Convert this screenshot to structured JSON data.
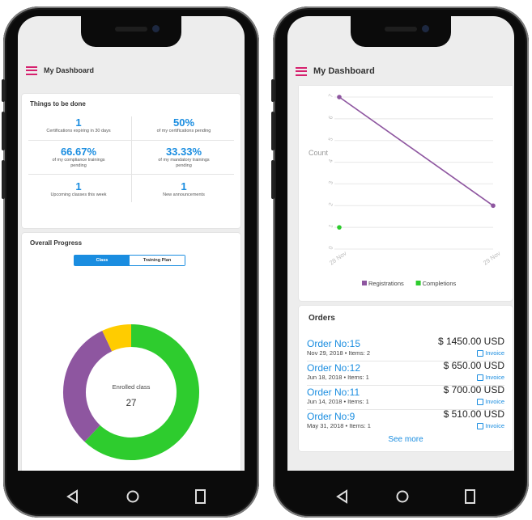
{
  "left_screen": {
    "app_title": "My Dashboard",
    "todo": {
      "title": "Things to be done",
      "stats": [
        {
          "value": "1",
          "label": "Certifications expiring in 30 days"
        },
        {
          "value": "50%",
          "label": "of my certifications pending"
        },
        {
          "value": "66.67%",
          "label": "of my compliance trainings pending"
        },
        {
          "value": "33.33%",
          "label": "of my mandatory trainings pending"
        },
        {
          "value": "1",
          "label": "Upcoming classes this week"
        },
        {
          "value": "1",
          "label": "New announcements"
        }
      ]
    },
    "progress": {
      "title": "Overall Progress",
      "tabs": [
        "Class",
        "Training Plan"
      ],
      "donut_label": "Enrolled class",
      "donut_value": "27",
      "segments": [
        {
          "fraction": 0.62,
          "color": "#2ecc2e"
        },
        {
          "fraction": 0.31,
          "color": "#8e56a0"
        },
        {
          "fraction": 0.07,
          "color": "#ffcc00"
        }
      ]
    }
  },
  "right_screen": {
    "app_title": "My Dashboard",
    "chart_data": {
      "type": "line",
      "ylabel": "Count",
      "y_ticks": [
        "0",
        "1",
        "2",
        "3",
        "4",
        "5",
        "6",
        "7"
      ],
      "x_ticks": [
        "28 Nov",
        "29 Nov"
      ],
      "ylim": [
        0,
        7
      ],
      "series": [
        {
          "name": "Registrations",
          "color": "#8e56a0",
          "values": [
            7,
            2
          ]
        },
        {
          "name": "Completions",
          "color": "#2ecc2e",
          "values": [
            1,
            null
          ]
        }
      ]
    },
    "orders": {
      "title": "Orders",
      "items": [
        {
          "number": "Order No:15",
          "meta": "Nov 29, 2018 • Items: 2",
          "amount": "$ 1450.00 USD",
          "invoice": "Invoice"
        },
        {
          "number": "Order No:12",
          "meta": "Jun 18, 2018 • Items: 1",
          "amount": "$ 650.00 USD",
          "invoice": "Invoice"
        },
        {
          "number": "Order No:11",
          "meta": "Jun 14, 2018 • Items: 1",
          "amount": "$ 700.00 USD",
          "invoice": "Invoice"
        },
        {
          "number": "Order No:9",
          "meta": "May 31, 2018 • Items: 1",
          "amount": "$ 510.00 USD",
          "invoice": "Invoice"
        }
      ],
      "see_more": "See more"
    }
  },
  "colors": {
    "accent": "#1a8de0",
    "menu": "#d6206e",
    "frame": "#0b0b0b"
  },
  "nav_icons": [
    "back-icon",
    "home-icon",
    "recents-icon"
  ]
}
